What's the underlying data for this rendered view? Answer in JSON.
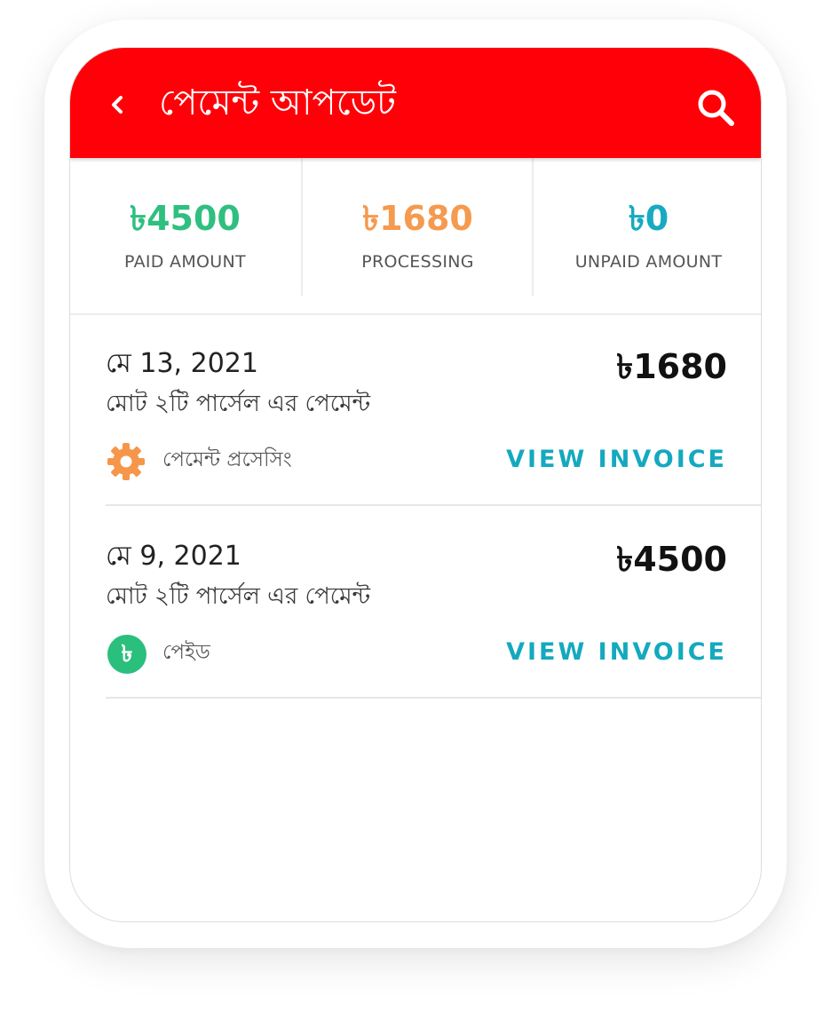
{
  "header": {
    "title": "পেমেন্ট আপডেট",
    "back_icon": "chevron-left-icon",
    "search_icon": "search-icon",
    "background_color": "#ff0008"
  },
  "summary": [
    {
      "value": "৳4500",
      "label": "PAID AMOUNT",
      "color": "#2fbf80"
    },
    {
      "value": "৳1680",
      "label": "PROCESSING",
      "color": "#f59a4e"
    },
    {
      "value": "৳0",
      "label": "UNPAID AMOUNT",
      "color": "#17aac0"
    }
  ],
  "payments": [
    {
      "date": "মে 13, 2021",
      "description": "মোট ২টি পার্সেল এর পেমেন্ট",
      "amount": "৳1680",
      "status": "পেমেন্ট প্রসেসিং",
      "status_icon": "gear-icon",
      "status_color": "#f5964a",
      "action": "VIEW INVOICE"
    },
    {
      "date": "মে 9, 2021",
      "description": "মোট ২টি পার্সেল এর পেমেন্ট",
      "amount": "৳4500",
      "status": "পেইড",
      "status_icon": "taka-circle-icon",
      "status_icon_glyph": "৳",
      "status_color": "#2bbf7e",
      "action": "VIEW INVOICE"
    }
  ],
  "accent_color": "#14a9bf"
}
